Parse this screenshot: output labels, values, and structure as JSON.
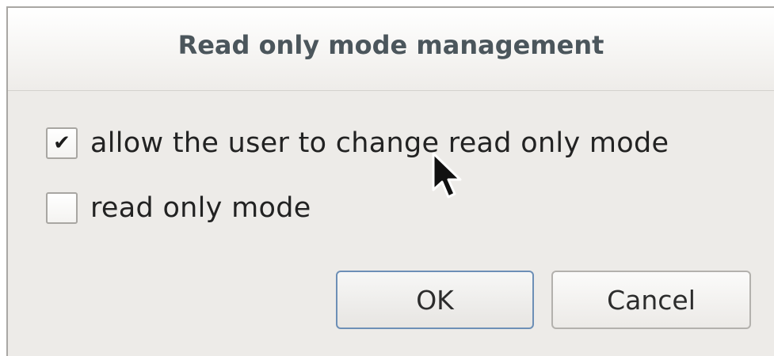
{
  "dialog": {
    "title": "Read only mode management"
  },
  "options": [
    {
      "label": "allow the user to change read only mode",
      "checked": true
    },
    {
      "label": "read only mode",
      "checked": false
    }
  ],
  "buttons": {
    "ok_label": "OK",
    "cancel_label": "Cancel"
  },
  "icons": {
    "check": "check-icon",
    "cursor": "mouse-pointer-icon"
  }
}
